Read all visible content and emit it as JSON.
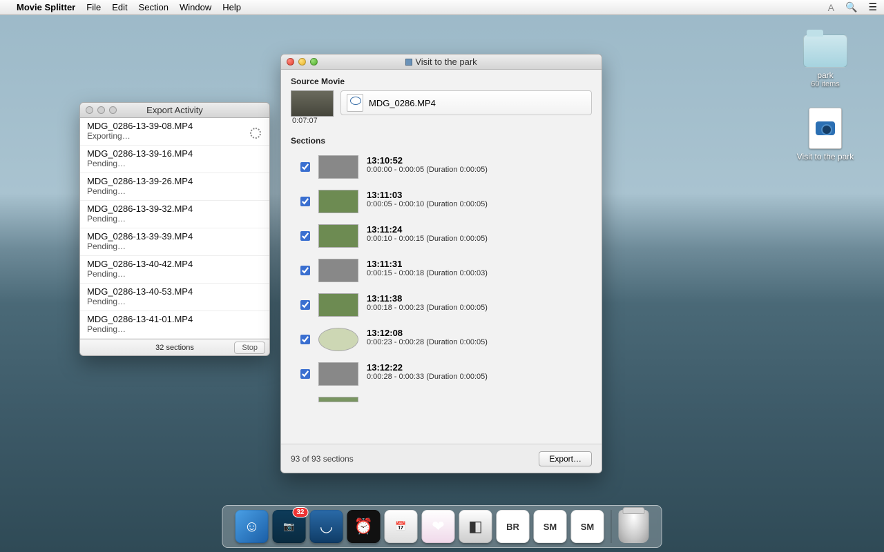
{
  "menubar": {
    "app_name": "Movie Splitter",
    "items": [
      "File",
      "Edit",
      "Section",
      "Window",
      "Help"
    ]
  },
  "desktop": {
    "folder": {
      "name": "park",
      "subtitle": "60 items"
    },
    "doc": {
      "name": "Visit to the park"
    }
  },
  "export_window": {
    "title": "Export Activity",
    "items": [
      {
        "file": "MDG_0286-13-39-08.MP4",
        "status": "Exporting…",
        "spinning": true
      },
      {
        "file": "MDG_0286-13-39-16.MP4",
        "status": "Pending…"
      },
      {
        "file": "MDG_0286-13-39-26.MP4",
        "status": "Pending…"
      },
      {
        "file": "MDG_0286-13-39-32.MP4",
        "status": "Pending…"
      },
      {
        "file": "MDG_0286-13-39-39.MP4",
        "status": "Pending…"
      },
      {
        "file": "MDG_0286-13-40-42.MP4",
        "status": "Pending…"
      },
      {
        "file": "MDG_0286-13-40-53.MP4",
        "status": "Pending…"
      },
      {
        "file": "MDG_0286-13-41-01.MP4",
        "status": "Pending…"
      }
    ],
    "footer": "32 sections",
    "stop_label": "Stop"
  },
  "main_window": {
    "title": "Visit to the park",
    "source_label": "Source Movie",
    "source_file": "MDG_0286.MP4",
    "source_duration": "0:07:07",
    "sections_label": "Sections",
    "sections": [
      {
        "time": "13:10:52",
        "range": "0:00:00 - 0:00:05 (Duration 0:00:05)",
        "checked": true,
        "thumb": "gray"
      },
      {
        "time": "13:11:03",
        "range": "0:00:05 - 0:00:10 (Duration 0:00:05)",
        "checked": true,
        "thumb": ""
      },
      {
        "time": "13:11:24",
        "range": "0:00:10 - 0:00:15 (Duration 0:00:05)",
        "checked": true,
        "thumb": ""
      },
      {
        "time": "13:11:31",
        "range": "0:00:15 - 0:00:18 (Duration 0:00:03)",
        "checked": true,
        "thumb": "gray"
      },
      {
        "time": "13:11:38",
        "range": "0:00:18 - 0:00:23 (Duration 0:00:05)",
        "checked": true,
        "thumb": ""
      },
      {
        "time": "13:12:08",
        "range": "0:00:23 - 0:00:28 (Duration 0:00:05)",
        "checked": true,
        "thumb": "light"
      },
      {
        "time": "13:12:22",
        "range": "0:00:28 - 0:00:33 (Duration 0:00:05)",
        "checked": true,
        "thumb": "gray"
      }
    ],
    "footer_count": "93 of 93 sections",
    "export_label": "Export…"
  },
  "dock": {
    "apps": [
      {
        "name": "finder",
        "bg": "linear-gradient(135deg,#4aa0e6,#1a5ea6)",
        "glyph": "☺",
        "badge": ""
      },
      {
        "name": "movie-splitter",
        "bg": "linear-gradient(#0d3b5a,#0a2b40)",
        "glyph": "📷",
        "badge": "32"
      },
      {
        "name": "app-blue",
        "bg": "linear-gradient(#2a6aa8,#0f3c66)",
        "glyph": "◡",
        "badge": ""
      },
      {
        "name": "alarm",
        "bg": "#111",
        "glyph": "⏰",
        "badge": ""
      },
      {
        "name": "calendar",
        "bg": "linear-gradient(#fff,#ddd)",
        "glyph": "📅",
        "badge": ""
      },
      {
        "name": "hearts",
        "bg": "linear-gradient(#fff,#f0d9ea)",
        "glyph": "❤",
        "badge": ""
      },
      {
        "name": "pmpro",
        "bg": "linear-gradient(#fff,#ccc)",
        "glyph": "◧",
        "badge": ""
      },
      {
        "name": "br",
        "bg": "#fff",
        "glyph": "BR",
        "badge": ""
      },
      {
        "name": "sm1",
        "bg": "#fff",
        "glyph": "SM",
        "badge": ""
      },
      {
        "name": "sm2",
        "bg": "#fff",
        "glyph": "SM",
        "badge": ""
      }
    ]
  }
}
